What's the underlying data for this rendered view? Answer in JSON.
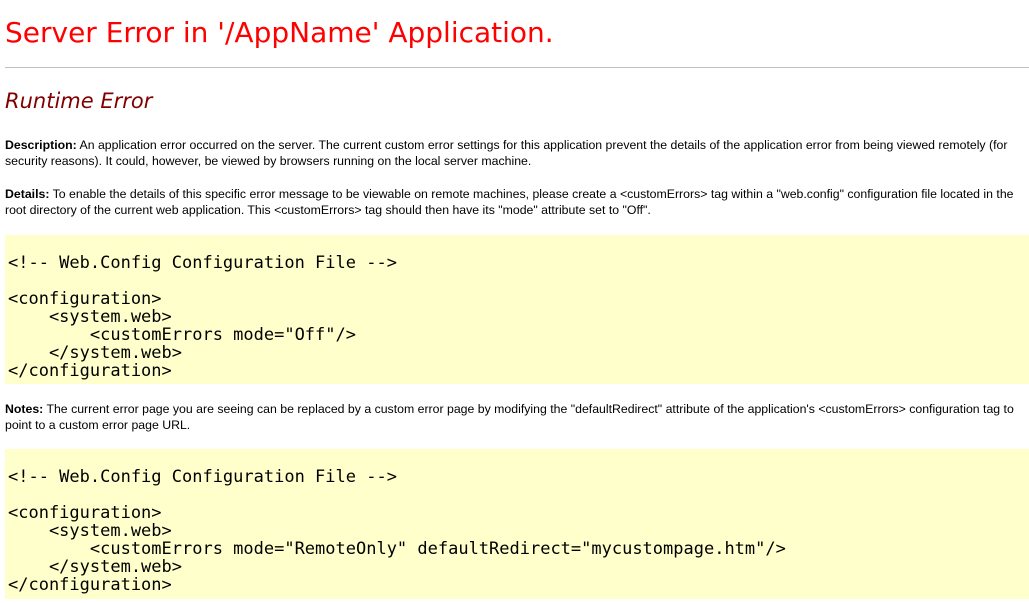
{
  "title": "Server Error in '/AppName' Application.",
  "subtitle": "Runtime Error",
  "description": {
    "label": "Description:",
    "text": " An application error occurred on the server. The current custom error settings for this application prevent the details of the application error from being viewed remotely (for security reasons). It could, however, be viewed by browsers running on the local server machine."
  },
  "details": {
    "label": "Details:",
    "text": " To enable the details of this specific error message to be viewable on remote machines, please create a <customErrors> tag within a \"web.config\" configuration file located in the root directory of the current web application. This <customErrors> tag should then have its \"mode\" attribute set to \"Off\"."
  },
  "code1": {
    "lines": [
      "<!-- Web.Config Configuration File -->",
      "",
      "<configuration>",
      "    <system.web>",
      "        <customErrors mode=\"Off\"/>",
      "    </system.web>",
      "</configuration>"
    ]
  },
  "notes": {
    "label": "Notes:",
    "text": " The current error page you are seeing can be replaced by a custom error page by modifying the \"defaultRedirect\" attribute of the application's <customErrors> configuration tag to point to a custom error page URL."
  },
  "code2": {
    "lines": [
      "<!-- Web.Config Configuration File -->",
      "",
      "<configuration>",
      "    <system.web>",
      "        <customErrors mode=\"RemoteOnly\" defaultRedirect=\"mycustompage.htm\"/>",
      "    </system.web>",
      "</configuration>"
    ]
  }
}
